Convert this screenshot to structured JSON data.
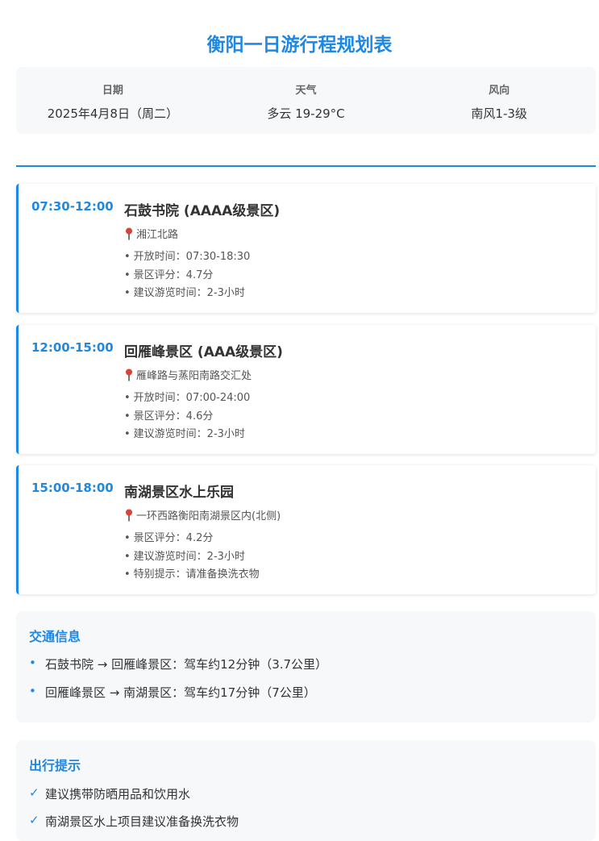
{
  "title": "衡阳一日游行程规划表",
  "info": {
    "date_label": "日期",
    "date_value": "2025年4月8日（周二）",
    "weather_label": "天气",
    "weather_value": "多云 19-29°C",
    "wind_label": "风向",
    "wind_value": "南风1-3级"
  },
  "itinerary": [
    {
      "time": "07:30-12:00",
      "name": "石鼓书院 (AAAA级景区)",
      "location": "湘江北路",
      "details": [
        "开放时间：07:30-18:30",
        "景区评分：4.7分",
        "建议游览时间：2-3小时"
      ]
    },
    {
      "time": "12:00-15:00",
      "name": "回雁峰景区 (AAA级景区)",
      "location": "雁峰路与蒸阳南路交汇处",
      "details": [
        "开放时间：07:00-24:00",
        "景区评分：4.6分",
        "建议游览时间：2-3小时"
      ]
    },
    {
      "time": "15:00-18:00",
      "name": "南湖景区水上乐园",
      "location": "一环西路衡阳南湖景区内(北侧)",
      "details": [
        "景区评分：4.2分",
        "建议游览时间：2-3小时",
        "特别提示：请准备换洗衣物"
      ]
    }
  ],
  "transport": {
    "title": "交通信息",
    "items": [
      "石鼓书院 → 回雁峰景区：驾车约12分钟（3.7公里）",
      "回雁峰景区 → 南湖景区：驾车约17分钟（7公里）"
    ]
  },
  "tips": {
    "title": "出行提示",
    "items": [
      "建议携带防晒用品和饮用水",
      "南湖景区水上项目建议准备换洗衣物"
    ]
  },
  "icons": {
    "pin": "round-pushpin-icon",
    "bullet": "bullet-icon",
    "check": "check-icon"
  },
  "colors": {
    "accent": "#1e88e5",
    "panel_bg": "#f6f8fa",
    "pin_red": "#d94335"
  }
}
